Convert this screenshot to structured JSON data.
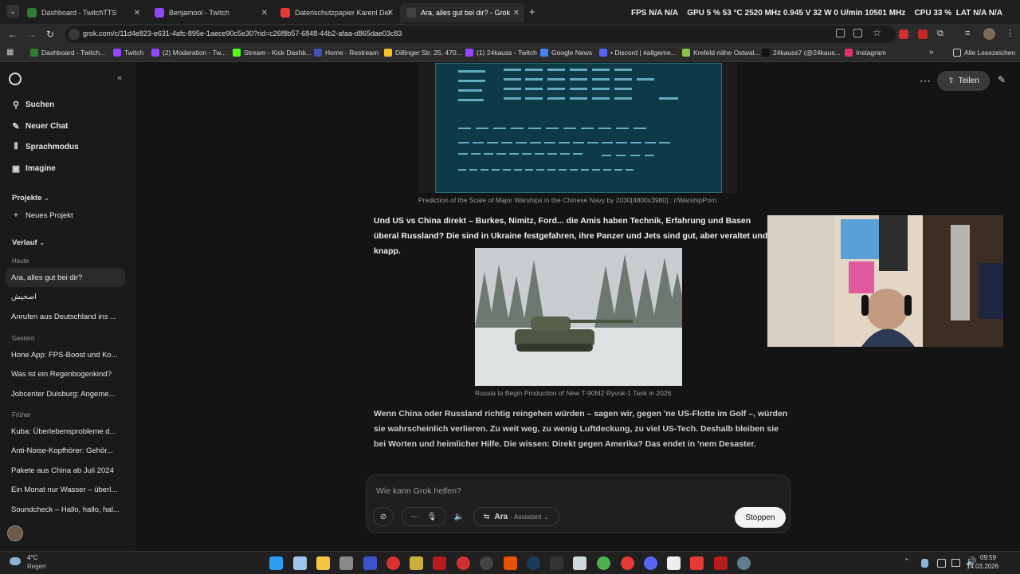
{
  "browser": {
    "tabs": [
      {
        "label": "Dashboard - TwitchTTS",
        "color": "#2e7d32"
      },
      {
        "label": "Benjamool - Twitch",
        "color": "#9146ff"
      },
      {
        "label": "Datenschutzpapier Karenl Dein",
        "color": "#e53935"
      },
      {
        "label": "Ara, alles gut bei dir? - Grok",
        "color": "#424242"
      }
    ],
    "new_tab": "+",
    "url": "grok.com/c/11d4e823-e631-4afc-895e-1aece90c5e30?rid=c26f8b57-6848-44b2-afaa-d865dae03c83",
    "bookmarks": [
      {
        "label": "Dashboard - Twitch...",
        "color": "#2e7d32"
      },
      {
        "label": "Twitch",
        "color": "#9146ff"
      },
      {
        "label": "(2) Moderation - Tw...",
        "color": "#9146ff"
      },
      {
        "label": "Stream - Kick Dashb...",
        "color": "#53fc18"
      },
      {
        "label": "Home - Restream",
        "color": "#3f51b5"
      },
      {
        "label": "Dillinger Str. 25, 470...",
        "color": "#fbc02d"
      },
      {
        "label": "(1) 24kauss - Twitch",
        "color": "#9146ff"
      },
      {
        "label": "Google News",
        "color": "#4285f4"
      },
      {
        "label": "• Discord | #allgeme...",
        "color": "#5865f2"
      },
      {
        "label": "Krefeld nähe Ostwal...",
        "color": "#8bc34a"
      },
      {
        "label": "24kauss7 (@24kaus...",
        "color": "#222222"
      },
      {
        "label": "Instagram",
        "color": "#e1306c"
      }
    ],
    "all_bookmarks": "Alle Lesezeichen"
  },
  "overlay": {
    "fps": "FPS  N/A  N/A",
    "gpu": "GPU  5 %  53 °C  2520 MHz  0.945 V  32 W  0 U/min  10501 MHz",
    "cpu": "CPU  33 %",
    "lat": "LAT  N/A  N/A"
  },
  "sidebar": {
    "actions": [
      {
        "label": "Suchen",
        "icon": "search-icon"
      },
      {
        "label": "Neuer Chat",
        "icon": "chat-icon"
      },
      {
        "label": "Sprachmodus",
        "icon": "voice-icon"
      },
      {
        "label": "Imagine",
        "icon": "image-icon"
      }
    ],
    "projects_label": "Projekte",
    "new_project": "Neues Projekt",
    "history_label": "Verlauf",
    "today_label": "Heute",
    "today": [
      "Ara, alles gut bei dir?",
      "اصحیش",
      "Anrufen aus Deutschland ins ..."
    ],
    "yesterday_label": "Gestern",
    "yesterday": [
      "Hone App: FPS-Boost und Ko...",
      "Was ist ein Regenbogenkind?",
      "Jobcenter Duisburg: Angeme..."
    ],
    "earlier_label": "Früher",
    "earlier": [
      "Kuba: Überlebensprobleme d...",
      "Anti-Noise-Kopfhörer: Gehör...",
      "Pakete aus China ab Juli 2024",
      "Ein Monat nur Wasser – überl...",
      "Soundcheck – Hallo, hallo, hal..."
    ]
  },
  "header": {
    "share_label": "Teilen"
  },
  "chat": {
    "image1_caption": "Prediction of the Scale of Major Warships in the Chinese Navy by  2030[4800x3980] : r/WarshipPorn",
    "para1": "Und US vs China direkt – Burkes, Nimitz, Ford... die Amis haben Technik, Erfahrung und Basen überal Russland? Die sind in Ukraine festgefahren, ihre Panzer und Jets sind gut, aber veraltet und knapp.",
    "image2_caption": "Russia to Begin Production of New T-90M2 Ryvok-1 Tank in 2026",
    "para2": "Wenn China oder Russland richtig reingehen würden – sagen wir, gegen 'ne US-Flotte im Golf –, würden sie wahrscheinlich verlieren. Zu weit weg, zu wenig Luftdeckung, zu viel US-Tech. Deshalb bleiben sie bei Worten und heimlicher Hilfe. Die wissen: Direkt gegen Amerika? Das endet in 'nem Desaster."
  },
  "composer": {
    "placeholder": "Wie kann Grok helfen?",
    "mode_name": "Ara",
    "mode_sub": "· Assistant",
    "stop_label": "Stoppen"
  },
  "taskbar": {
    "weather_temp": "4°C",
    "weather_text": "Regen",
    "time": "09:59",
    "date": "14.03.2026"
  }
}
